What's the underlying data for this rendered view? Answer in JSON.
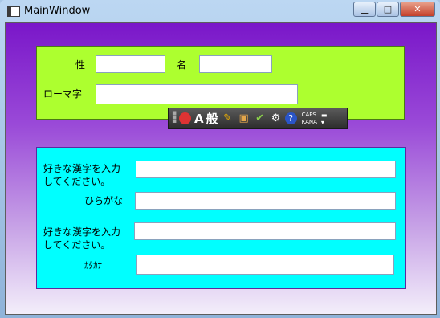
{
  "window": {
    "title": "MainWindow"
  },
  "form_top": {
    "surname_label": "性",
    "given_label": "名",
    "romaji_label": "ローマ字",
    "surname_value": "",
    "given_value": "",
    "romaji_value": ""
  },
  "form_bottom": {
    "kanji1_label_line1": "好きな漢字を入力",
    "kanji1_label_line2": "してください。",
    "hiragana_label": "ひらがな",
    "kanji2_label_line1": "好きな漢字を入力",
    "kanji2_label_line2": "してください。",
    "katakana_label": "ｶﾀｶﾅ",
    "kanji1_value": "",
    "hiragana_value": "",
    "kanji2_value": "",
    "katakana_value": ""
  },
  "ime_bar": {
    "input_mode": "A",
    "conversion_mode": "般",
    "caps_label": "CAPS",
    "kana_label": "KANA",
    "help_glyph": "?"
  },
  "colors": {
    "top_panel": "#adff2f",
    "bottom_panel": "#00ffff",
    "client_gradient_top": "#7a17c9"
  }
}
